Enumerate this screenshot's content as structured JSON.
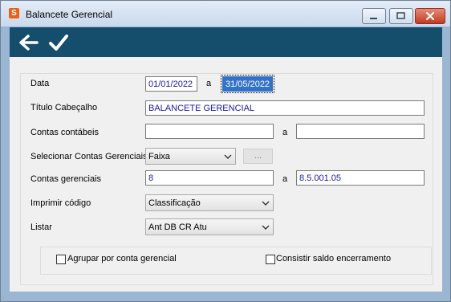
{
  "window": {
    "title": "Balancete Gerencial",
    "app_icon_glyph": "S",
    "accent": "#154d6c"
  },
  "toolbar": {
    "back_icon": "arrow-left-icon",
    "confirm_icon": "checkmark-icon"
  },
  "form": {
    "data_label": "Data",
    "data_from": "01/01/2022",
    "data_sep": "a",
    "data_to": "31/05/2022",
    "titulo_label": "Título Cabeçalho",
    "titulo_value": "BALANCETE GERENCIAL",
    "contas_contabeis_label": "Contas contábeis",
    "contas_contabeis_from": "",
    "contas_contabeis_sep": "a",
    "contas_contabeis_to": "",
    "selecionar_label": "Selecionar Contas Gerenciais",
    "selecionar_value": "Faixa",
    "dots_label": "...",
    "contas_gerenciais_label": "Contas gerenciais",
    "contas_gerenciais_from": "8",
    "contas_gerenciais_sep": "a",
    "contas_gerenciais_to": "8.5.001.05",
    "imprimir_label": "Imprimir código",
    "imprimir_value": "Classificação",
    "listar_label": "Listar",
    "listar_value": "Ant DB CR Atu",
    "agrupar_label": "Agrupar por conta gerencial",
    "agrupar_checked": false,
    "consistir_label": "Consistir saldo encerramento",
    "consistir_checked": false
  }
}
